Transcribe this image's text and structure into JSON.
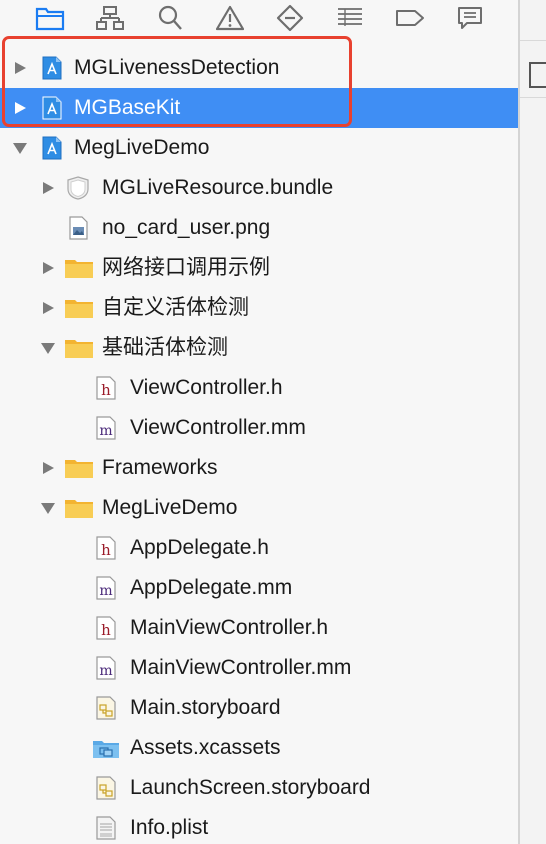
{
  "toolbar": {
    "icons": [
      "folder-icon",
      "hierarchy-icon",
      "search-icon",
      "warning-icon",
      "test-diamond-icon",
      "list-icon",
      "breakpoint-icon",
      "report-icon"
    ]
  },
  "tree": {
    "items": [
      {
        "label": "MGLivenessDetection",
        "icon": "xcode-project-icon",
        "expanded": false,
        "selected": false
      },
      {
        "label": "MGBaseKit",
        "icon": "xcode-project-icon",
        "expanded": false,
        "selected": true
      },
      {
        "label": "MegLiveDemo",
        "icon": "xcode-project-icon",
        "expanded": true,
        "selected": false
      },
      {
        "label": "MGLiveResource.bundle",
        "icon": "bundle-icon",
        "expanded": false
      },
      {
        "label": "no_card_user.png",
        "icon": "image-file-icon"
      },
      {
        "label": "网络接口调用示例",
        "icon": "folder-icon",
        "expanded": false
      },
      {
        "label": "自定义活体检测",
        "icon": "folder-icon",
        "expanded": false
      },
      {
        "label": "基础活体检测",
        "icon": "folder-icon",
        "expanded": true
      },
      {
        "label": "ViewController.h",
        "icon": "header-file-icon"
      },
      {
        "label": "ViewController.mm",
        "icon": "objc-file-icon"
      },
      {
        "label": "Frameworks",
        "icon": "folder-icon",
        "expanded": false
      },
      {
        "label": "MegLiveDemo",
        "icon": "folder-icon",
        "expanded": true
      },
      {
        "label": "AppDelegate.h",
        "icon": "header-file-icon"
      },
      {
        "label": "AppDelegate.mm",
        "icon": "objc-file-icon"
      },
      {
        "label": "MainViewController.h",
        "icon": "header-file-icon"
      },
      {
        "label": "MainViewController.mm",
        "icon": "objc-file-icon"
      },
      {
        "label": "Main.storyboard",
        "icon": "storyboard-icon"
      },
      {
        "label": "Assets.xcassets",
        "icon": "asset-catalog-icon"
      },
      {
        "label": "LaunchScreen.storyboard",
        "icon": "storyboard-icon"
      },
      {
        "label": "Info.plist",
        "icon": "plist-file-icon"
      }
    ]
  },
  "colors": {
    "selection": "#3f8ef4",
    "highlight_border": "#e8412f",
    "folder": "#f6c243",
    "toolbar_active": "#1b7cf2"
  }
}
